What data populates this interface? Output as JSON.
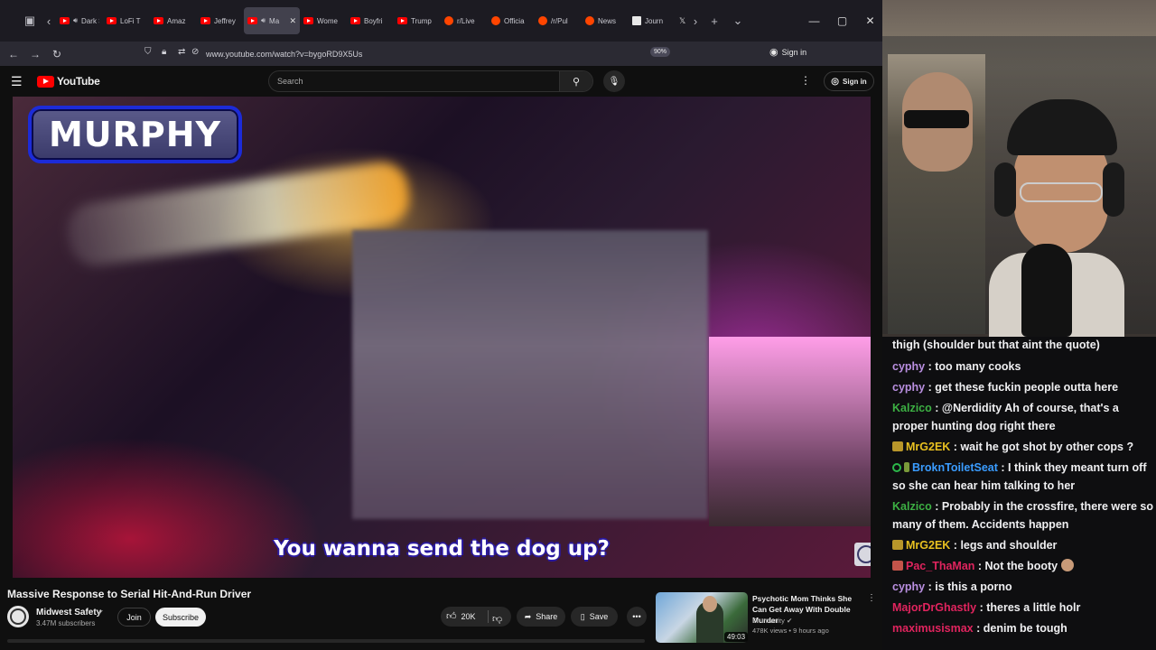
{
  "browser": {
    "tabs": [
      {
        "title": "Dark S",
        "favicon": "youtube",
        "active": false,
        "audio": true
      },
      {
        "title": "LoFi T",
        "favicon": "youtube",
        "active": false,
        "audio": false
      },
      {
        "title": "Amaz",
        "favicon": "youtube",
        "active": false,
        "audio": false
      },
      {
        "title": "Jeffrey",
        "favicon": "youtube",
        "active": false,
        "audio": false
      },
      {
        "title": "Ma",
        "favicon": "youtube",
        "active": true,
        "audio": true
      },
      {
        "title": "Wome",
        "favicon": "youtube",
        "active": false,
        "audio": false
      },
      {
        "title": "Boyfri",
        "favicon": "youtube",
        "active": false,
        "audio": false
      },
      {
        "title": "Trump",
        "favicon": "youtube",
        "active": false,
        "audio": false
      },
      {
        "title": "r/Live",
        "favicon": "reddit",
        "active": false,
        "audio": false
      },
      {
        "title": "Officia",
        "favicon": "reddit",
        "active": false,
        "audio": false
      },
      {
        "title": "/r/Pul",
        "favicon": "reddit",
        "active": false,
        "audio": false
      },
      {
        "title": "News",
        "favicon": "reddit",
        "active": false,
        "audio": false
      },
      {
        "title": "Journ",
        "favicon": "ap",
        "active": false,
        "audio": false
      }
    ],
    "url": "www.youtube.com/watch?v=bygoRD9X5Us",
    "zoom": "90%",
    "signin_label": "Sign in"
  },
  "youtube": {
    "logo_text": "YouTube",
    "search_placeholder": "Search",
    "signin_label": "Sign in",
    "video": {
      "overlay_name": "MURPHY",
      "caption": "You wanna send the dog up?",
      "title": "Massive Response to Serial Hit-And-Run Driver",
      "channel": "Midwest Safety",
      "verified_icon": "✔",
      "subscribers": "3.47M subscribers",
      "join_label": "Join",
      "subscribe_label": "Subscribe",
      "likes": "20K",
      "share_label": "Share",
      "save_label": "Save"
    },
    "recommendation": {
      "title": "Psychotic Mom Thinks She Can Get Away With Double Murder",
      "channel": "Dr Insanity",
      "meta": "478K views • 9 hours ago",
      "duration": "49:03"
    }
  },
  "chat": {
    "messages": [
      {
        "user": "",
        "user_color": "#efeff1",
        "text": "thigh (shoulder but that aint the quote)",
        "badges": []
      },
      {
        "user": "cyphy",
        "user_color": "#b98fe0",
        "text": "too many cooks",
        "badges": []
      },
      {
        "user": "cyphy",
        "user_color": "#b98fe0",
        "text": "get these fuckin people outta here",
        "badges": []
      },
      {
        "user": "Kalzico",
        "user_color": "#3cb043",
        "text": "@Nerdidity Ah of course, that's a proper hunting dog right there",
        "badges": []
      },
      {
        "user": "MrG2EK",
        "user_color": "#e8c020",
        "text": "wait he got shot by other cops ?",
        "badges": [
          "gift"
        ]
      },
      {
        "user": "BroknToiletSeat",
        "user_color": "#3a9cff",
        "text": "I think they meant turn off so she can hear him talking to her",
        "badges": [
          "star",
          "leaf"
        ]
      },
      {
        "user": "Kalzico",
        "user_color": "#3cb043",
        "text": "Probably in the crossfire, there were so many of them. Accidents happen",
        "badges": []
      },
      {
        "user": "MrG2EK",
        "user_color": "#e8c020",
        "text": "legs and shoulder",
        "badges": [
          "gift"
        ]
      },
      {
        "user": "Pac_ThaMan",
        "user_color": "#e0245e",
        "text": "Not the booty",
        "badges": [
          "gift2"
        ],
        "emote": true
      },
      {
        "user": "cyphy",
        "user_color": "#b98fe0",
        "text": "is this a porno",
        "badges": []
      },
      {
        "user": "MajorDrGhastly",
        "user_color": "#e0245e",
        "text": "theres a little holr",
        "badges": []
      },
      {
        "user": "maximusismax",
        "user_color": "#e0245e",
        "text": "denim be tough",
        "badges": []
      }
    ]
  }
}
